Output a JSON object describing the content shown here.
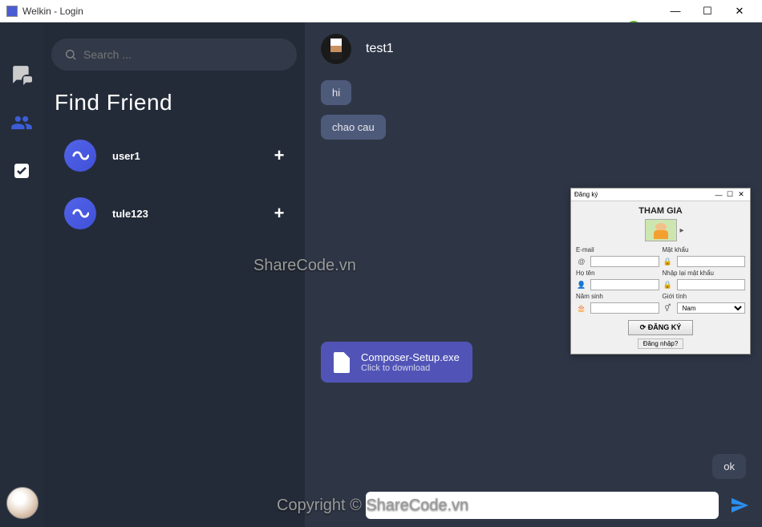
{
  "window": {
    "title": "Welkin - Login"
  },
  "brand": {
    "part1": "SHARE",
    "part2": "CODE",
    "tld": ".vn"
  },
  "search": {
    "placeholder": "Search ..."
  },
  "section_title": "Find Friend",
  "friends": [
    {
      "name": "user1"
    },
    {
      "name": "tule123"
    }
  ],
  "chat": {
    "username": "test1",
    "messages": [
      {
        "side": "left",
        "text": "hi"
      },
      {
        "side": "left",
        "text": "chao cau"
      },
      {
        "side": "right",
        "text": "ok"
      }
    ],
    "file": {
      "name": "Composer-Setup.exe",
      "subtitle": "Click to download"
    }
  },
  "watermarks": {
    "center": "ShareCode.vn",
    "bottom": "Copyright © ShareCode.vn"
  },
  "dialog": {
    "title": "Đăng ký",
    "heading": "THAM GIA",
    "labels": {
      "email": "E-mail",
      "password": "Mật khẩu",
      "fullname": "Họ tên",
      "repeat": "Nhập lại mật khẩu",
      "birth": "Năm sinh",
      "gender": "Giới tính"
    },
    "gender_value": "Nam",
    "submit": "ĐĂNG KÝ",
    "login_link": "Đăng nhập?"
  }
}
